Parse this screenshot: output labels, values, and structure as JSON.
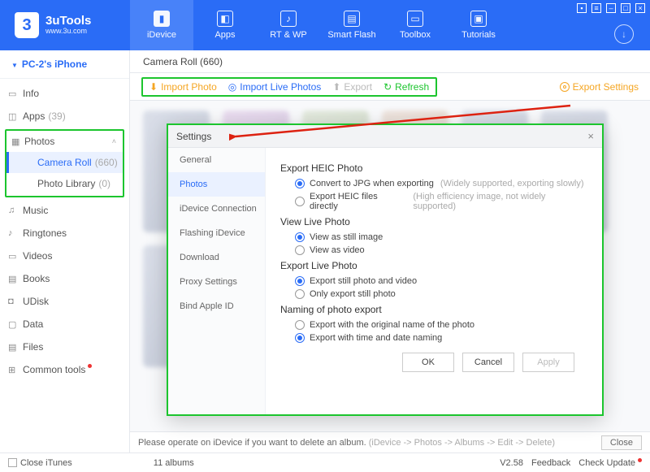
{
  "app": {
    "name": "3uTools",
    "url": "www.3u.com"
  },
  "topnav": [
    "iDevice",
    "Apps",
    "RT & WP",
    "Smart Flash",
    "Toolbox",
    "Tutorials"
  ],
  "device": "PC-2's iPhone",
  "sidebar": {
    "info": "Info",
    "apps": "Apps",
    "apps_count": "(39)",
    "photos": "Photos",
    "cr": "Camera Roll",
    "cr_count": "(660)",
    "pl": "Photo Library",
    "pl_count": "(0)",
    "music": "Music",
    "ringtones": "Ringtones",
    "videos": "Videos",
    "books": "Books",
    "udisk": "UDisk",
    "data": "Data",
    "files": "Files",
    "common": "Common tools"
  },
  "breadcrumb": "Camera Roll (660)",
  "toolbar": {
    "import_photo": "Import Photo",
    "import_live": "Import Live Photos",
    "export": "Export",
    "refresh": "Refresh",
    "export_settings": "Export Settings"
  },
  "hint": {
    "text": "Please operate on iDevice if you want to delete an album.",
    "path": "(iDevice -> Photos -> Albums -> Edit -> Delete)",
    "close": "Close"
  },
  "status": {
    "close_itunes": "Close iTunes",
    "albums": "11 albums",
    "version": "V2.58",
    "feedback": "Feedback",
    "check_update": "Check Update"
  },
  "dialog": {
    "title": "Settings",
    "tabs": [
      "General",
      "Photos",
      "iDevice Connection",
      "Flashing iDevice",
      "Download",
      "Proxy Settings",
      "Bind Apple ID"
    ],
    "s1": "Export HEIC Photo",
    "s1o1": "Convert to JPG when exporting",
    "s1h1": "(Widely supported, exporting slowly)",
    "s1o2": "Export HEIC files directly",
    "s1h2": "(High efficiency image, not widely supported)",
    "s2": "View Live Photo",
    "s2o1": "View as still image",
    "s2o2": "View as video",
    "s3": "Export Live Photo",
    "s3o1": "Export still photo and video",
    "s3o2": "Only export still photo",
    "s4": "Naming of photo export",
    "s4o1": "Export with the original name of the photo",
    "s4o2": "Export with time and date naming",
    "ok": "OK",
    "cancel": "Cancel",
    "apply": "Apply"
  }
}
